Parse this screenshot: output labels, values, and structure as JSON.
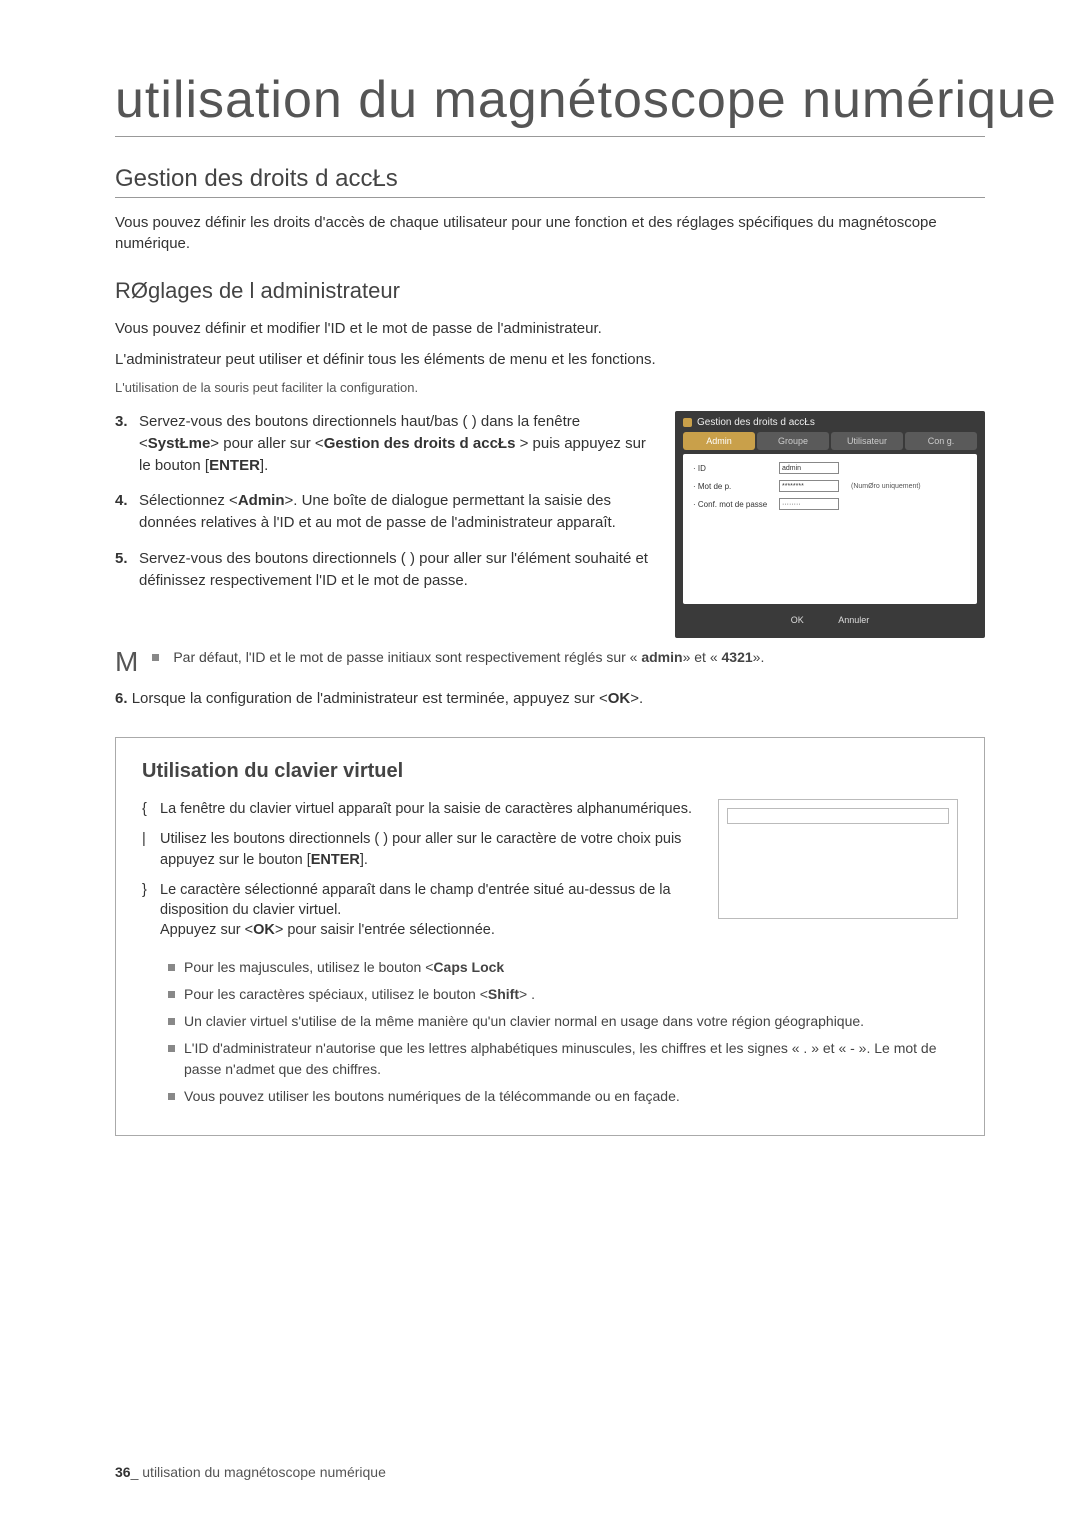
{
  "chapter": {
    "title": "utilisation du magnétoscope numérique"
  },
  "section": {
    "title": "Gestion des droits d accŁs",
    "intro": "Vous pouvez définir les droits d'accès de chaque utilisateur pour une fonction et des réglages spécifiques du magnétoscope numérique."
  },
  "subsection": {
    "title": "RØglages de l administrateur",
    "line1": "Vous pouvez définir et modifier l'ID et le mot de passe de l'administrateur.",
    "line2": "L'administrateur peut utiliser et définir tous les éléments de menu et les fonctions.",
    "mouse_note": "L'utilisation de la souris peut faciliter la configuration."
  },
  "steps": {
    "s3": {
      "num": "3.",
      "pre": "Servez-vous des boutons directionnels haut/bas (        ) dans la fenêtre <",
      "b1": "SystŁme",
      "mid1": "> pour aller sur <",
      "b2": "Gestion des droits d accŁs",
      "mid2": " > puis appuyez sur le bouton [",
      "b3": "ENTER",
      "end": "]."
    },
    "s4": {
      "num": "4.",
      "pre": "Sélectionnez <",
      "b1": "Admin",
      "post": ">. Une boîte de dialogue permettant la saisie des données relatives à l'ID et au mot de passe de l'administrateur apparaît."
    },
    "s5": {
      "num": "5.",
      "text": "Servez-vous des boutons directionnels (             ) pour aller sur l'élément souhaité et définissez respectivement l'ID et le mot de passe."
    },
    "s6": {
      "num": "6.",
      "pre": "Lorsque la configuration de l'administrateur est terminée, appuyez sur <",
      "b1": "OK",
      "post": ">."
    }
  },
  "note": {
    "pre": "Par défaut, l'ID et le mot de passe initiaux sont respectivement réglés sur « ",
    "b1": "admin",
    "mid": "» et « ",
    "b2": "4321",
    "post": "»."
  },
  "ui": {
    "title": "Gestion des droits d accŁs",
    "tabs": {
      "t1": "Admin",
      "t2": "Groupe",
      "t3": "Utilisateur",
      "t4": "Con g."
    },
    "fields": {
      "id_label": "· ID",
      "id_value": "admin",
      "pw_label": "· Mot de p.",
      "pw_value": "********",
      "pw_hint": "(NumØro uniquement)",
      "cpw_label": "· Conf. mot de passe",
      "cpw_value": "········"
    },
    "buttons": {
      "ok": "OK",
      "cancel": "Annuler"
    }
  },
  "vk": {
    "title": "Utilisation du clavier virtuel",
    "items": {
      "i1": {
        "marker": "{",
        "text": "La fenêtre du clavier virtuel apparaît pour la saisie de caractères alphanumériques."
      },
      "i2": {
        "marker": "|",
        "pre": "Utilisez les boutons directionnels (              ) pour aller sur le caractère de votre choix puis appuyez sur le bouton [",
        "b": "ENTER",
        "post": "]."
      },
      "i3": {
        "marker": "}",
        "pre": "Le caractère sélectionné apparaît dans le champ d'entrée situé au-dessus de la disposition du clavier virtuel.\nAppuyez sur <",
        "b": "OK",
        "post": "> pour saisir l'entrée sélectionnée."
      }
    },
    "bullets": {
      "b1_pre": "Pour les majuscules, utilisez le bouton <",
      "b1_b": "Caps Lock",
      "b1_post": "",
      "b2_pre": "Pour les caractères spéciaux, utilisez le bouton <",
      "b2_b": "Shift",
      "b2_post": "> .",
      "b3": "Un clavier virtuel s'utilise de la même manière qu'un clavier normal en usage dans votre région géographique.",
      "b4": "L'ID d'administrateur n'autorise que les lettres alphabétiques minuscules, les chiffres et les signes « . » et « - ». Le mot de passe n'admet que des chiffres.",
      "b5": "Vous pouvez utiliser les boutons numériques de la télécommande ou en façade."
    }
  },
  "footer": {
    "page": "36",
    "sep": "_ ",
    "text": "utilisation du magnétoscope numérique"
  }
}
